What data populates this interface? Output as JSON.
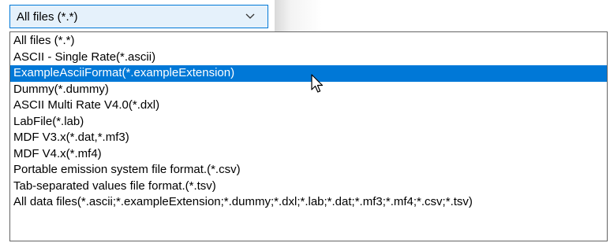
{
  "combo": {
    "selected_value": "All files (*.*)",
    "arrow_icon": "chevron-down-icon"
  },
  "dropdown": {
    "selected_index": 2,
    "options": [
      "All files (*.*)",
      "ASCII - Single Rate(*.ascii)",
      "ExampleAsciiFormat(*.exampleExtension)",
      "Dummy(*.dummy)",
      "ASCII Multi Rate V4.0(*.dxl)",
      "LabFile(*.lab)",
      "MDF V3.x(*.dat,*.mf3)",
      "MDF V4.x(*.mf4)",
      "Portable emission system file format.(*.csv)",
      "Tab-separated values file format.(*.tsv)",
      "All data files(*.ascii;*.exampleExtension;*.dummy;*.dxl;*.lab;*.dat;*.mf3;*.mf4;*.csv;*.tsv)"
    ]
  },
  "colors": {
    "selection": "#0078d7",
    "combo_border": "#0078d7",
    "combo_background": "#e5f1fb",
    "dropdown_border": "#646464"
  },
  "cursor_icon": "mouse-pointer-icon"
}
